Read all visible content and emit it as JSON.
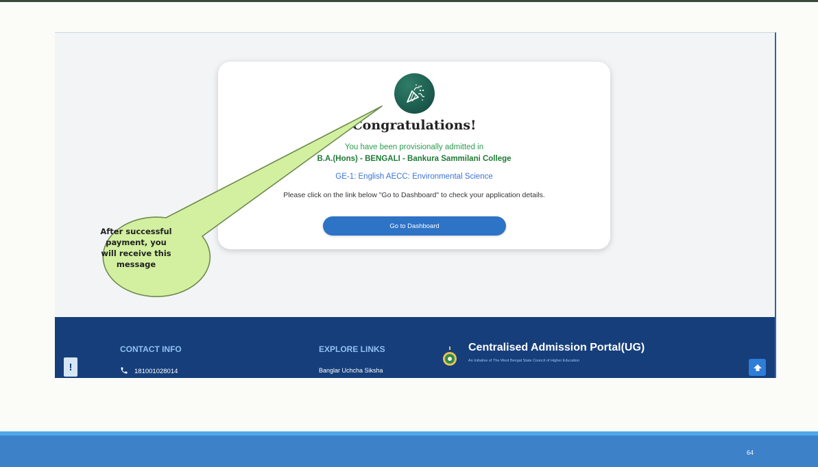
{
  "modal": {
    "title": "Congratulations!",
    "admitted_line": "You have been provisionally admitted in",
    "course": "B.A.(Hons) - BENGALI - Bankura Sammilani College",
    "subjects": "GE-1: English AECC: Environmental Science",
    "instruction": "Please click on the link below \"Go to Dashboard\" to check your application details.",
    "button_label": "Go to Dashboard",
    "icon": "party-popper-icon"
  },
  "footer": {
    "contact_heading": "CONTACT INFO",
    "phone": "181001028014",
    "explore_heading": "EXPLORE LINKS",
    "explore_link": "Banglar Uchcha Siksha",
    "portal_title": "Centralised Admission Portal(UG)",
    "portal_tagline": "An Initiative of The West Bengal State Council of Higher Education",
    "feedback_symbol": "!",
    "icons": [
      "phone-icon",
      "emblem-icon",
      "feedback-icon",
      "arrow-up-icon"
    ]
  },
  "callout": {
    "lines": [
      "After successful",
      "payment, you",
      "will receive this",
      "message"
    ]
  },
  "slide": {
    "page_number": "64"
  },
  "colors": {
    "footer_bg": "#163e7b",
    "button_bg": "#2d73c6",
    "success_green": "#2a9b4d",
    "callout_fill": "#d3f0a0",
    "slide_bar": "#3d82c9"
  }
}
